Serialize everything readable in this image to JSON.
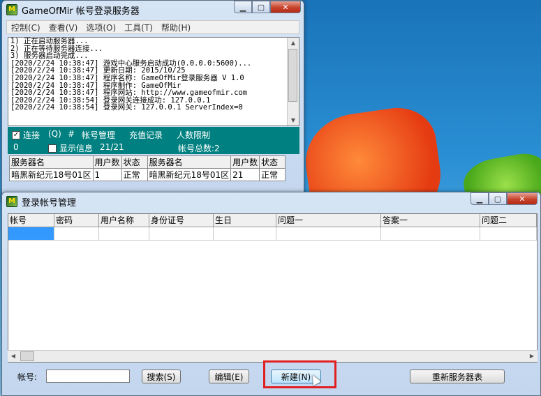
{
  "win1": {
    "title": "GameOfMir 帐号登录服务器",
    "menu": [
      "控制(C)",
      "查看(V)",
      "选项(O)",
      "工具(T)",
      "帮助(H)"
    ],
    "log": [
      "1) 正在启动服务器...",
      "2) 正在等待服务器连接...",
      "3) 服务器启动完成...",
      "[2020/2/24 10:38:47] 游戏中心服务启动成功(0.0.0.0:5600)...",
      "[2020/2/24 10:38:47] 更新日期: 2015/10/25",
      "[2020/2/24 10:38:47] 程序名称: GameOfMir登录服务器 V 1.0",
      "[2020/2/24 10:38:47] 程序制作: GameOfMir",
      "[2020/2/24 10:38:47] 程序网站: http://www.gameofmir.com",
      "[2020/2/24 10:38:54] 登录网关连接成功: 127.0.0.1",
      "[2020/2/24 10:38:54] 登录网关: 127.0.0.1 ServerIndex=0"
    ],
    "panel": {
      "connect_label": "连接",
      "q_label": "(Q)",
      "hash_label": "#",
      "account_mgmt": "帐号管理",
      "recharge": "充值记录",
      "limit": "人数限制",
      "zero": "0",
      "show_info": "显示信息",
      "ratio": "21/21",
      "total": "帐号总数:2"
    },
    "server_table": {
      "headers": [
        "服务器名",
        "用户数",
        "状态",
        "服务器名",
        "用户数",
        "状态"
      ],
      "rows": [
        [
          "暗黑新纪元18号01区",
          "1",
          "正常",
          "暗黑新纪元18号01区",
          "21",
          "正常"
        ]
      ]
    }
  },
  "win2": {
    "title": "登录帐号管理",
    "columns": [
      "帐号",
      "密码",
      "用户名称",
      "身份证号",
      "生日",
      "问题一",
      "答案一",
      "问题二"
    ],
    "account_label": "帐号:",
    "account_value": "",
    "search_label": "搜索(S)",
    "edit_label": "编辑(E)",
    "new_label": "新建(N)",
    "refresh_label": "重新服务器表"
  },
  "colors": {
    "panel": "#008080",
    "selection": "#3399ff",
    "highlight": "#e02020"
  },
  "icons": {
    "minimize": "minimize-icon",
    "maximize": "maximize-icon",
    "close": "close-icon"
  }
}
